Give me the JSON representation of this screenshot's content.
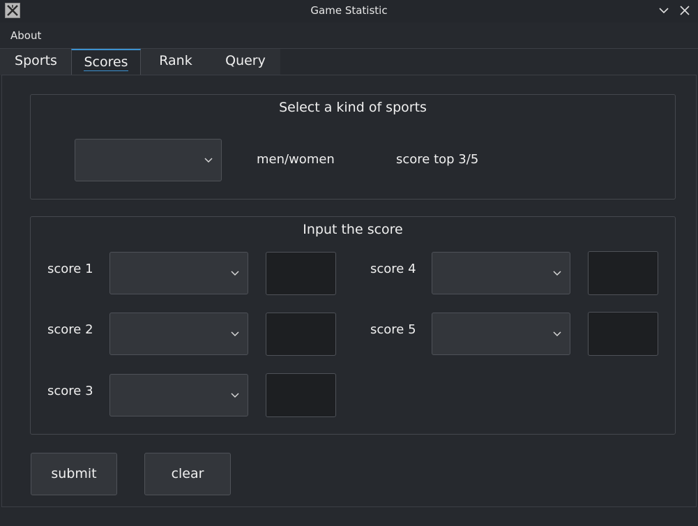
{
  "window": {
    "title": "Game Statistic"
  },
  "menu": {
    "about": "About"
  },
  "tabs": [
    {
      "label": "Sports",
      "active": false
    },
    {
      "label": "Scores",
      "active": true
    },
    {
      "label": "Rank",
      "active": false
    },
    {
      "label": "Query",
      "active": false
    }
  ],
  "select_group": {
    "title": "Select a kind of sports",
    "sport_selected": "",
    "gender_label": "men/women",
    "score_top_label": "score top 3/5"
  },
  "input_group": {
    "title": "Input the score",
    "rows": [
      {
        "label": "score 1",
        "selected": "",
        "value": ""
      },
      {
        "label": "score 2",
        "selected": "",
        "value": ""
      },
      {
        "label": "score 3",
        "selected": "",
        "value": ""
      },
      {
        "label": "score 4",
        "selected": "",
        "value": ""
      },
      {
        "label": "score 5",
        "selected": "",
        "value": ""
      }
    ]
  },
  "actions": {
    "submit": "submit",
    "clear": "clear"
  },
  "colors": {
    "accent": "#3c92d0",
    "background": "#26292e",
    "field": "#1d1f22"
  }
}
